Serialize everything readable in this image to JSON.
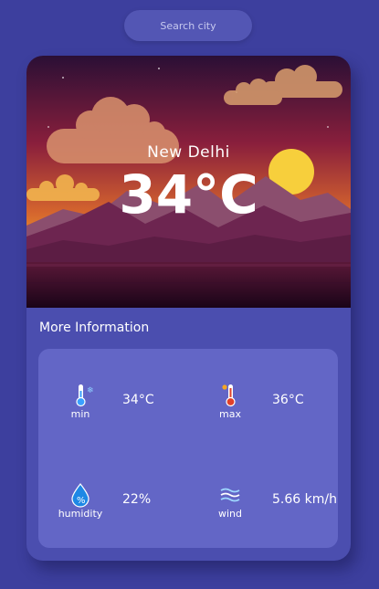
{
  "search": {
    "placeholder": "Search city"
  },
  "weather": {
    "city": "New Delhi",
    "temperature": "34°C"
  },
  "more_info": {
    "title": "More Information",
    "stats": [
      {
        "label": "min",
        "value": "34°C",
        "icon": "thermometer-cold-icon"
      },
      {
        "label": "max",
        "value": "36°C",
        "icon": "thermometer-hot-icon"
      },
      {
        "label": "humidity",
        "value": "22%",
        "icon": "humidity-icon"
      },
      {
        "label": "wind",
        "value": "5.66 km/h",
        "icon": "wind-icon"
      }
    ]
  },
  "colors": {
    "background": "#3d3f9e",
    "card": "#4b4eaf",
    "panel": "#6366c6",
    "sky_top": "#2a0f35",
    "sky_horizon": "#e69025"
  }
}
